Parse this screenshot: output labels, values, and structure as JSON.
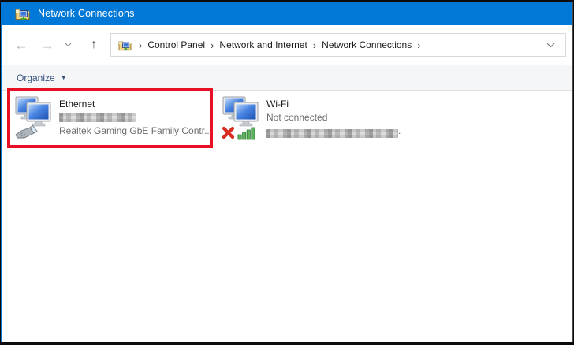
{
  "window": {
    "accent_color": "#0078d7",
    "highlight_color": "#e81123"
  },
  "titlebar": {
    "icon": "network-connections-folder-icon",
    "title": "Network Connections"
  },
  "navbar": {
    "back_glyph": "←",
    "forward_glyph": "→",
    "up_glyph": "↑",
    "history_chevron": "chevron-down-icon",
    "address": {
      "icon": "network-connections-folder-icon",
      "separator": "›",
      "crumbs": [
        "Control Panel",
        "Network and Internet",
        "Network Connections"
      ],
      "dropdown": "chevron-down-icon"
    }
  },
  "toolbar": {
    "organize_label": "Organize",
    "organize_caret": "▼"
  },
  "items": {
    "ethernet": {
      "icon": "ethernet-adapter-icon",
      "name": "Ethernet",
      "network_name_redacted": true,
      "device": "Realtek Gaming GbE Family Contr...",
      "highlighted": true
    },
    "wifi": {
      "icon": "wifi-adapter-icon",
      "name": "Wi-Fi",
      "status": "Not connected",
      "adapter_redacted": true,
      "adapter_suffix": "."
    }
  }
}
